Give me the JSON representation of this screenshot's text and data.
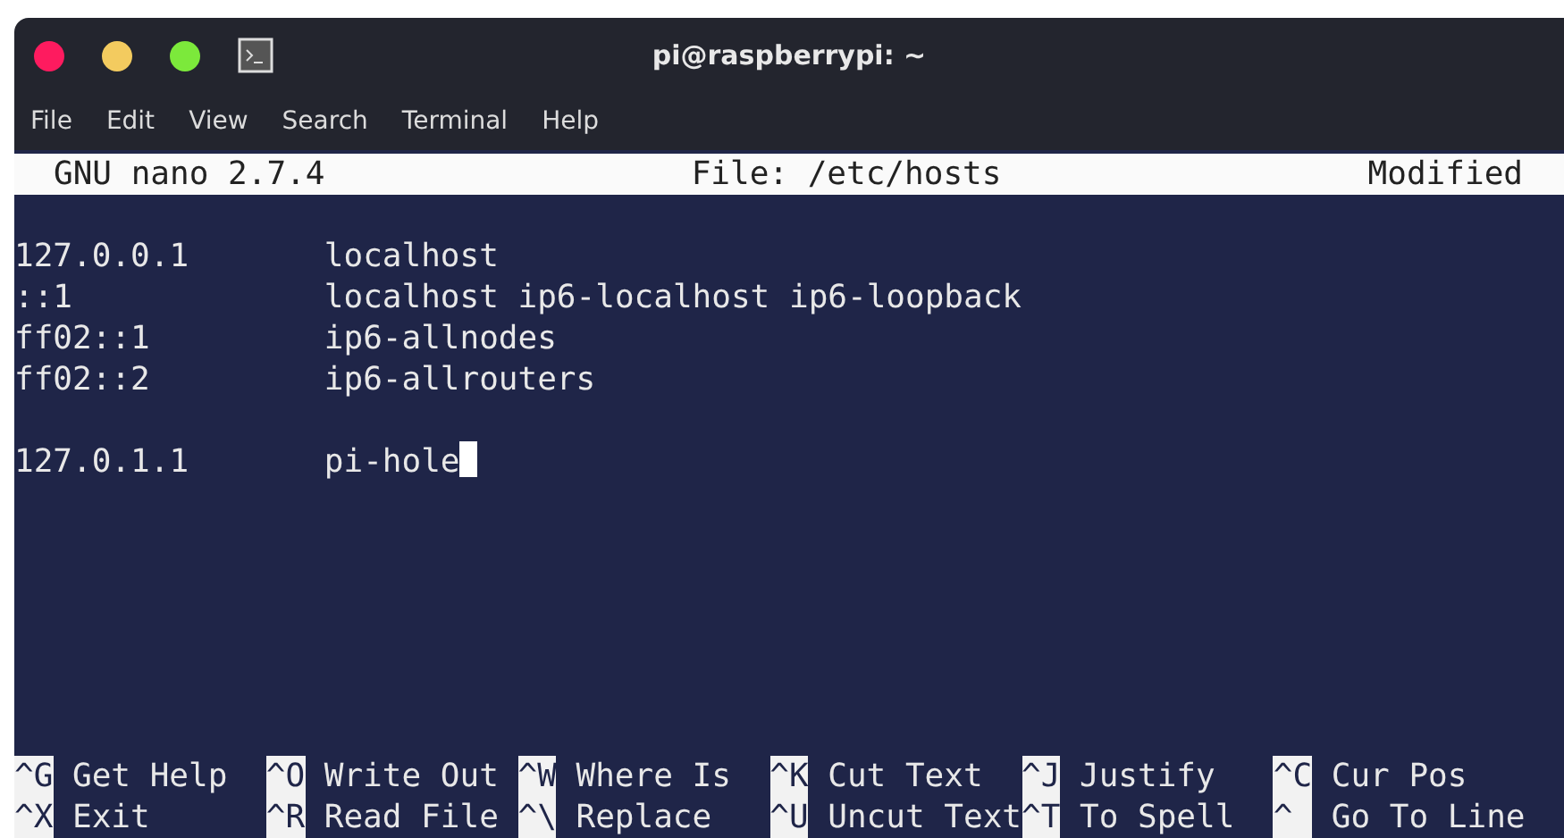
{
  "window": {
    "title": "pi@raspberrypi: ~"
  },
  "menu": [
    "File",
    "Edit",
    "View",
    "Search",
    "Terminal",
    "Help"
  ],
  "nano_header": {
    "version": "GNU nano 2.7.4",
    "file": "File: /etc/hosts",
    "status": "Modified"
  },
  "blocks": [
    [
      {
        "address": "127.0.0.1",
        "names": "localhost",
        "cursor": false
      },
      {
        "address": "::1",
        "names": "localhost ip6-localhost ip6-loopback",
        "cursor": false
      },
      {
        "address": "ff02::1",
        "names": "ip6-allnodes",
        "cursor": false
      },
      {
        "address": "ff02::2",
        "names": "ip6-allrouters",
        "cursor": false
      }
    ],
    [
      {
        "address": "127.0.1.1",
        "names": "pi-hole",
        "cursor": true
      }
    ]
  ],
  "shortcuts": [
    [
      {
        "key": "^G",
        "label": "Get Help"
      },
      {
        "key": "^O",
        "label": "Write Out"
      },
      {
        "key": "^W",
        "label": "Where Is"
      },
      {
        "key": "^K",
        "label": "Cut Text"
      },
      {
        "key": "^J",
        "label": "Justify"
      },
      {
        "key": "^C",
        "label": "Cur Pos"
      }
    ],
    [
      {
        "key": "^X",
        "label": "Exit"
      },
      {
        "key": "^R",
        "label": "Read File"
      },
      {
        "key": "^\\",
        "label": "Replace"
      },
      {
        "key": "^U",
        "label": "Uncut Text"
      },
      {
        "key": "^T",
        "label": "To Spell"
      },
      {
        "key": "^",
        "label": "Go To Line"
      }
    ]
  ]
}
